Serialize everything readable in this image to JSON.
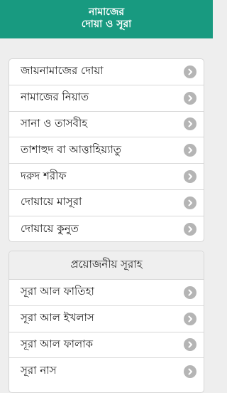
{
  "header": {
    "title_line1": "নামাজের",
    "title_line2": "দোয়া ও সূরা"
  },
  "group1": {
    "items": [
      {
        "label": "জায়নামাজের দোয়া"
      },
      {
        "label": "নামাজের নিয়াত"
      },
      {
        "label": "সানা ও তাসবীহ"
      },
      {
        "label": "তাশাহুদ বা আত্তাহিয়্যাতু"
      },
      {
        "label": "দরুদ শরীফ"
      },
      {
        "label": "দোয়ায়ে মাসূরা"
      },
      {
        "label": "দোয়ায়ে কুনুত"
      }
    ]
  },
  "group2": {
    "section_title": "প্রয়োজনীয় সূরাহ",
    "items": [
      {
        "label": "সূরা আল ফাতিহা"
      },
      {
        "label": "সূরা আল ইখলাস"
      },
      {
        "label": "সূরা আল ফালাক"
      },
      {
        "label": "সূরা নাস"
      }
    ]
  },
  "colors": {
    "header_bg": "#189a80",
    "header_text": "#ffffff",
    "chevron_bg": "#b5b5b5"
  },
  "icons": {
    "row_indicator": "chevron-right-icon"
  }
}
